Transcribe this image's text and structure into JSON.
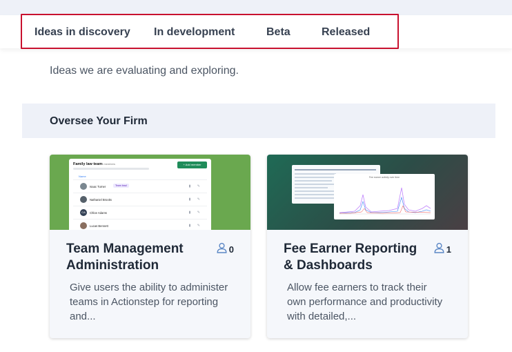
{
  "tabs": [
    {
      "label": "Ideas in discovery"
    },
    {
      "label": "In development"
    },
    {
      "label": "Beta"
    },
    {
      "label": "Released"
    }
  ],
  "tab_description": "Ideas we are evaluating and exploring.",
  "section": {
    "title": "Oversee Your Firm"
  },
  "cards": [
    {
      "title": "Team Management Administration",
      "votes": "0",
      "description": "Give users the ability to administer teams in Actionstep for reporting and...",
      "thumbnail": {
        "panel_title": "Family law team",
        "panel_subtitle": "8 members",
        "add_button": "+ Add member",
        "column_header": "Name",
        "rows": [
          {
            "name": "Isaac Turner",
            "tag": "Team lead"
          },
          {
            "name": "Nathaniel Brooks",
            "tag": ""
          },
          {
            "name": "Chloe Adams",
            "tag": "",
            "initials": "CA"
          },
          {
            "name": "Lucas Bennett",
            "tag": ""
          }
        ]
      }
    },
    {
      "title": "Fee Earner Reporting & Dashboards",
      "votes": "1",
      "description": "Allow fee earners to track their own performance and productivity with detailed,...",
      "thumbnail": {
        "chart_title": "Fee earner activity over time"
      }
    }
  ],
  "colors": {
    "highlight": "#c8102e",
    "section_bg": "#eef1f8",
    "card_bg": "#f5f7fb",
    "vote_icon": "#5b87c5",
    "thumb_green": "#6aa84f"
  },
  "icons": {
    "votes": "user-icon"
  }
}
